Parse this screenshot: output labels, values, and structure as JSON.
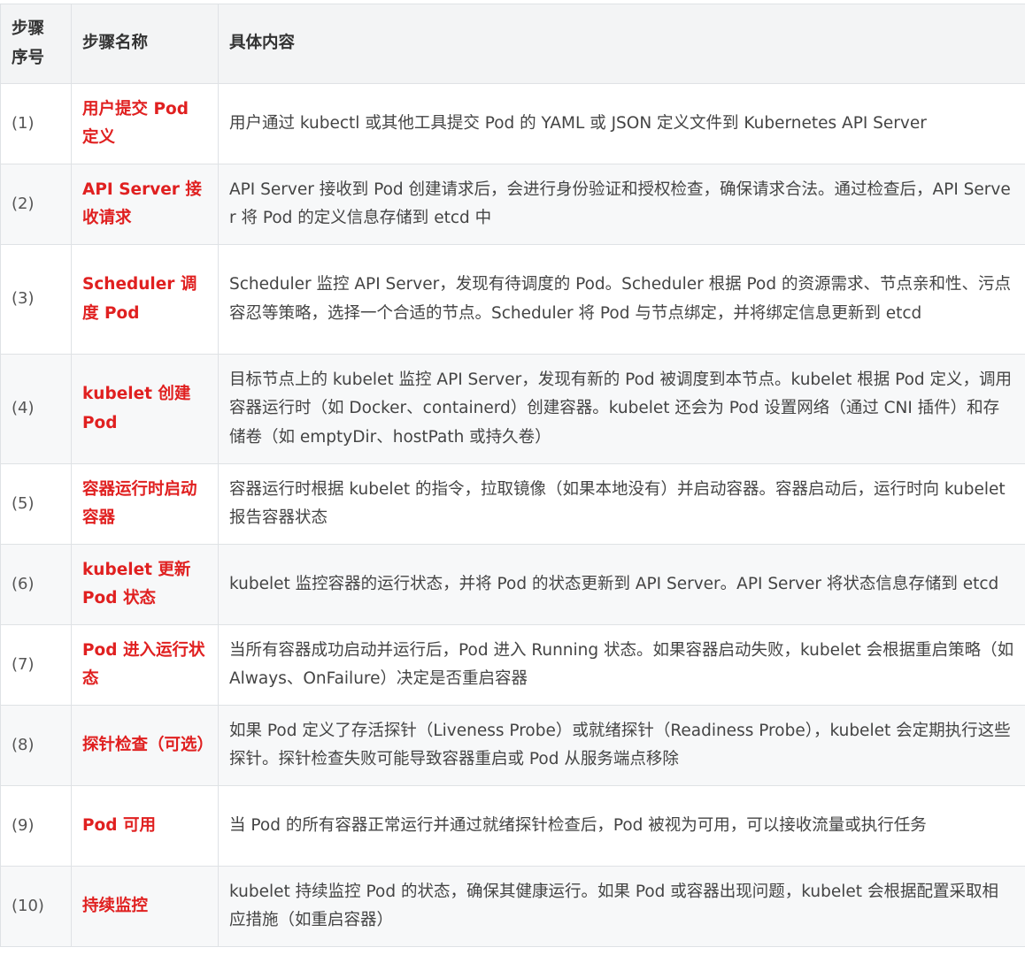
{
  "table": {
    "headers": [
      "步骤序号",
      "步骤名称",
      "具体内容"
    ],
    "rows": [
      {
        "no": "(1)",
        "name": "用户提交 Pod 定义",
        "desc": "用户通过 kubectl 或其他工具提交 Pod 的 YAML 或 JSON 定义文件到 Kubernetes API Server"
      },
      {
        "no": "(2)",
        "name": "API Server 接收请求",
        "desc": "API Server 接收到 Pod 创建请求后，会进行身份验证和授权检查，确保请求合法。通过检查后，API Server 将 Pod 的定义信息存储到 etcd 中"
      },
      {
        "no": "(3)",
        "name": "Scheduler 调度 Pod",
        "desc": "Scheduler 监控 API Server，发现有待调度的 Pod。Scheduler 根据 Pod 的资源需求、节点亲和性、污点容忍等策略，选择一个合适的节点。Scheduler 将 Pod 与节点绑定，并将绑定信息更新到 etcd"
      },
      {
        "no": "(4)",
        "name": "kubelet 创建 Pod",
        "desc": "目标节点上的 kubelet 监控 API Server，发现有新的 Pod 被调度到本节点。kubelet 根据 Pod 定义，调用容器运行时（如 Docker、containerd）创建容器。kubelet 还会为 Pod 设置网络（通过 CNI 插件）和存储卷（如 emptyDir、hostPath 或持久卷）"
      },
      {
        "no": "(5)",
        "name": "容器运行时启动容器",
        "desc": "容器运行时根据 kubelet 的指令，拉取镜像（如果本地没有）并启动容器。容器启动后，运行时向 kubelet 报告容器状态"
      },
      {
        "no": "(6)",
        "name": "kubelet 更新 Pod 状态",
        "desc": "kubelet 监控容器的运行状态，并将 Pod 的状态更新到 API Server。API Server 将状态信息存储到 etcd"
      },
      {
        "no": "(7)",
        "name": "Pod 进入运行状态",
        "desc": "当所有容器成功启动并运行后，Pod 进入 Running 状态。如果容器启动失败，kubelet 会根据重启策略（如 Always、OnFailure）决定是否重启容器"
      },
      {
        "no": "(8)",
        "name": "探针检查（可选）",
        "desc": "如果 Pod 定义了存活探针（Liveness Probe）或就绪探针（Readiness Probe），kubelet 会定期执行这些探针。探针检查失败可能导致容器重启或 Pod 从服务端点移除"
      },
      {
        "no": "(9)",
        "name": "Pod 可用",
        "desc": "当 Pod 的所有容器正常运行并通过就绪探针检查后，Pod 被视为可用，可以接收流量或执行任务"
      },
      {
        "no": "(10)",
        "name": "持续监控",
        "desc": "kubelet 持续监控 Pod 的状态，确保其健康运行。如果 Pod 或容器出现问题，kubelet 会根据配置采取相应措施（如重启容器）"
      }
    ]
  }
}
